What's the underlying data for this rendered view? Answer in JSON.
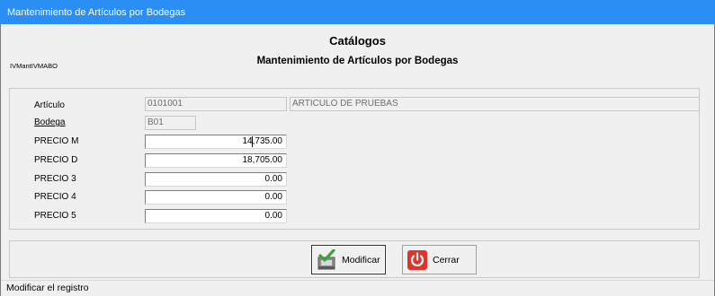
{
  "window": {
    "title": "Mantenimiento de Artículos por Bodegas"
  },
  "header": {
    "title": "Catálogos",
    "subtitle": "Mantenimiento de Artículos por Bodegas",
    "form_code": "IVMantIVMABO"
  },
  "form": {
    "articulo": {
      "label": "Artículo",
      "code": "0101001",
      "description": "ARTICULO DE PRUEBAS"
    },
    "bodega": {
      "label": "Bodega",
      "code": "B01"
    },
    "prices": [
      {
        "label": "PRECIO M",
        "value": "14,735.00"
      },
      {
        "label": "PRECIO D",
        "value": "18,705.00"
      },
      {
        "label": "PRECIO 3",
        "value": "0.00"
      },
      {
        "label": "PRECIO 4",
        "value": "0.00"
      },
      {
        "label": "PRECIO 5",
        "value": "0.00"
      }
    ]
  },
  "buttons": {
    "modificar": {
      "label": "Modificar",
      "icon": "save-check-icon"
    },
    "cerrar": {
      "label": "Cerrar",
      "icon": "power-icon"
    }
  },
  "status": {
    "text": "Modificar el registro"
  },
  "colors": {
    "titlebar": "#2b8ef2",
    "cerrar_icon": "#e0332b",
    "modificar_icon": "#3aa63a"
  }
}
